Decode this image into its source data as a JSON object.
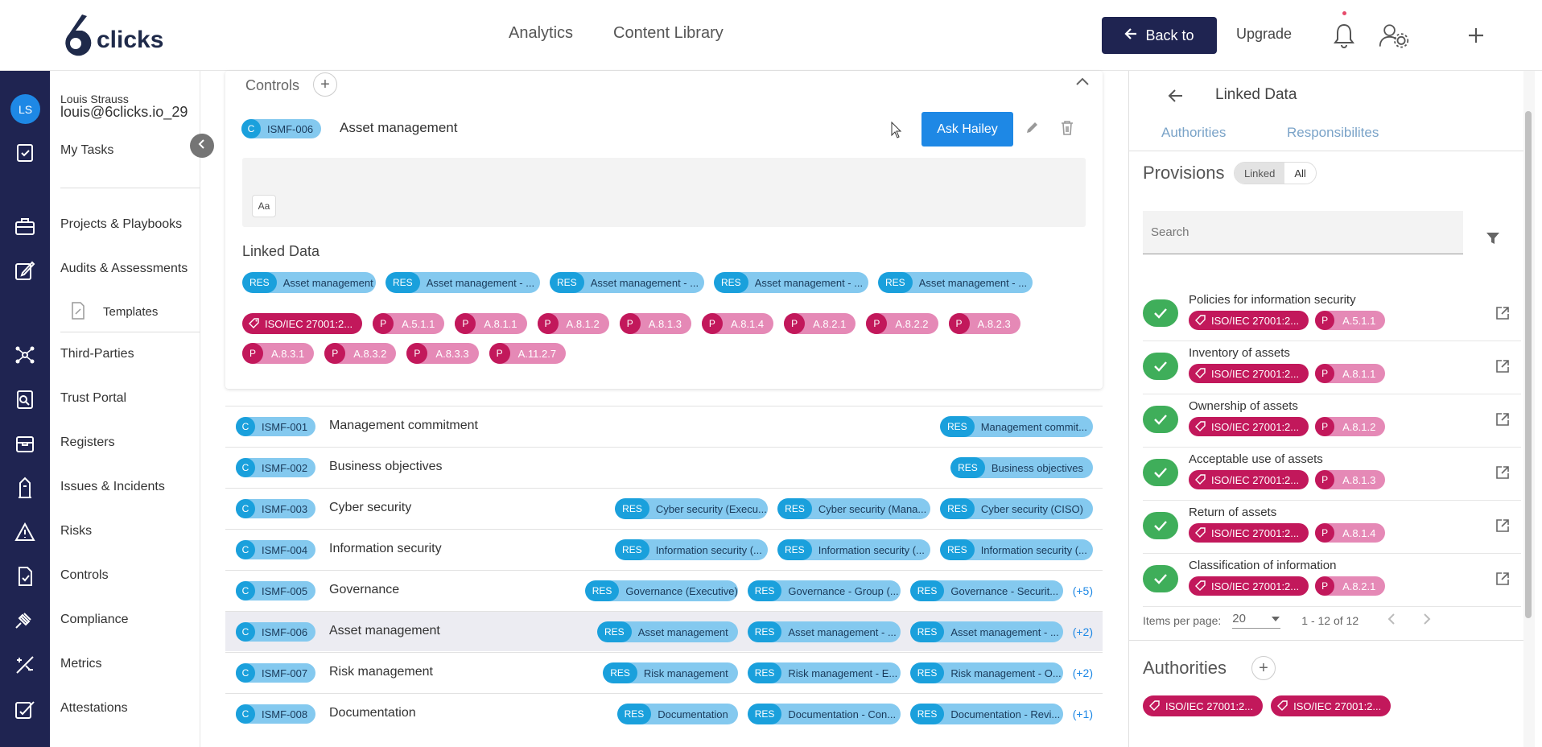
{
  "brand": {
    "logo_text": "clicks",
    "logo_digit": "6"
  },
  "topnav": {
    "analytics": "Analytics",
    "content_library": "Content Library",
    "back_label": "Back to",
    "upgrade": "Upgrade"
  },
  "user": {
    "initials": "LS",
    "name": "Louis Strauss",
    "email": "louis@6clicks.io_29"
  },
  "sidebar": {
    "items": [
      {
        "label": "My Tasks"
      },
      {
        "label": "Projects & Playbooks"
      },
      {
        "label": "Audits & Assessments"
      },
      {
        "label": "Templates"
      },
      {
        "label": "Third-Parties"
      },
      {
        "label": "Trust Portal"
      },
      {
        "label": "Registers"
      },
      {
        "label": "Issues & Incidents"
      },
      {
        "label": "Risks"
      },
      {
        "label": "Controls"
      },
      {
        "label": "Compliance"
      },
      {
        "label": "Metrics"
      },
      {
        "label": "Attestations"
      }
    ]
  },
  "controls": {
    "title": "Controls",
    "expanded": {
      "prefix": "C",
      "code": "ISMF-006",
      "name": "Asset management",
      "ask_label": "Ask Hailey",
      "aa": "Aa",
      "linked_data_title": "Linked Data",
      "res_tag": "RES",
      "res": [
        "Asset management",
        "Asset management - ...",
        "Asset management - ...",
        "Asset management - ...",
        "Asset management - ..."
      ],
      "authority": "ISO/IEC 27001:2...",
      "p_tag": "P",
      "provisions": [
        "A.5.1.1",
        "A.8.1.1",
        "A.8.1.2",
        "A.8.1.3",
        "A.8.1.4",
        "A.8.2.1",
        "A.8.2.2",
        "A.8.2.3",
        "A.8.3.1",
        "A.8.3.2",
        "A.8.3.3",
        "A.11.2.7"
      ]
    },
    "rows": [
      {
        "code": "ISMF-001",
        "name": "Management commitment",
        "res": [
          "Management commit..."
        ],
        "more": ""
      },
      {
        "code": "ISMF-002",
        "name": "Business objectives",
        "res": [
          "Business objectives"
        ],
        "more": ""
      },
      {
        "code": "ISMF-003",
        "name": "Cyber security",
        "res": [
          "Cyber security (Execu...",
          "Cyber security (Mana...",
          "Cyber security (CISO)"
        ],
        "more": ""
      },
      {
        "code": "ISMF-004",
        "name": "Information security",
        "res": [
          "Information security (...",
          "Information security (...",
          "Information security (..."
        ],
        "more": ""
      },
      {
        "code": "ISMF-005",
        "name": "Governance",
        "res": [
          "Governance (Executive)",
          "Governance - Group (...",
          "Governance - Securit..."
        ],
        "more": "(+5)"
      },
      {
        "code": "ISMF-006",
        "name": "Asset management",
        "res": [
          "Asset management",
          "Asset management - ...",
          "Asset management - ..."
        ],
        "more": "(+2)"
      },
      {
        "code": "ISMF-007",
        "name": "Risk management",
        "res": [
          "Risk management",
          "Risk management - E...",
          "Risk management - O..."
        ],
        "more": "(+2)"
      },
      {
        "code": "ISMF-008",
        "name": "Documentation",
        "res": [
          "Documentation",
          "Documentation - Con...",
          "Documentation - Revi..."
        ],
        "more": "(+1)"
      }
    ]
  },
  "linked_panel": {
    "title": "Linked Data",
    "tabs": [
      "Authorities",
      "Responsibilites"
    ],
    "provisions_title": "Provisions",
    "toggle": [
      "Linked",
      "All"
    ],
    "search_placeholder": "Search",
    "provisions": [
      {
        "name": "Policies for information security",
        "auth": "ISO/IEC 27001:2...",
        "p": "A.5.1.1"
      },
      {
        "name": "Inventory of assets",
        "auth": "ISO/IEC 27001:2...",
        "p": "A.8.1.1"
      },
      {
        "name": "Ownership of assets",
        "auth": "ISO/IEC 27001:2...",
        "p": "A.8.1.2"
      },
      {
        "name": "Acceptable use of assets",
        "auth": "ISO/IEC 27001:2...",
        "p": "A.8.1.3"
      },
      {
        "name": "Return of assets",
        "auth": "ISO/IEC 27001:2...",
        "p": "A.8.1.4"
      },
      {
        "name": "Classification of information",
        "auth": "ISO/IEC 27001:2...",
        "p": "A.8.2.1"
      }
    ],
    "items_per_page_label": "Items per page:",
    "items_per_page": "20",
    "range": "1 - 12 of 12",
    "authorities_title": "Authorities",
    "authorities": [
      "ISO/IEC 27001:2...",
      "ISO/IEC 27001:2..."
    ]
  },
  "colors": {
    "navy": "#1f2451",
    "primary": "#1e88e5",
    "res": "#1aa0dc",
    "authority": "#c2185b",
    "success": "#3fae5a"
  }
}
